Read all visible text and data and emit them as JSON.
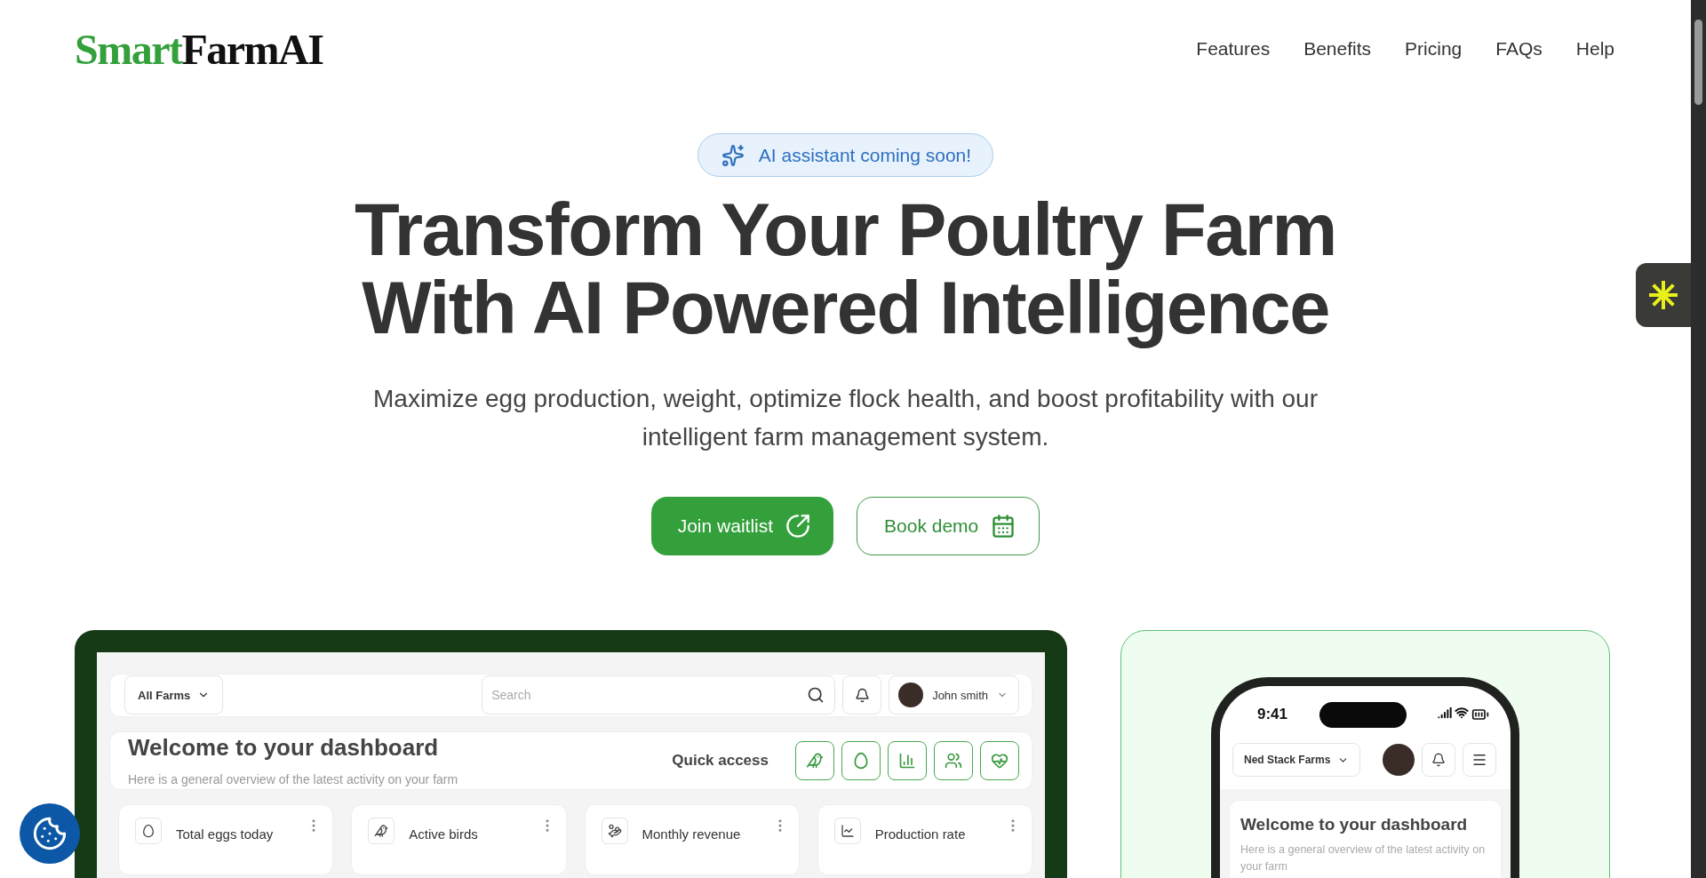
{
  "header": {
    "logo": {
      "accent": "Smart",
      "rest": "FarmAI"
    },
    "nav": [
      "Features",
      "Benefits",
      "Pricing",
      "FAQs",
      "Help"
    ]
  },
  "badge": "AI assistant coming soon!",
  "hero": {
    "title_lines": [
      "Transform Your Poultry Farm",
      "With AI Powered Intelligence"
    ],
    "subtitle_lines": [
      "Maximize egg production, weight, optimize flock health, and boost profitability with our",
      "intelligent farm management system."
    ]
  },
  "buttons": [
    {
      "label": "Join waitlist",
      "kind": "primary"
    },
    {
      "label": "Book demo",
      "kind": "outline"
    }
  ],
  "dashboard": {
    "farm_select": "All Farms",
    "search": {
      "placeholder": "Search"
    },
    "user": "John smith",
    "welcome": {
      "title": "Welcome to your dashboard",
      "subtitle": "Here is a general overview of the latest activity on your farm"
    },
    "quick_access": {
      "label": "Quick access",
      "items": [
        {
          "kind": "bird"
        },
        {
          "kind": "egg"
        },
        {
          "kind": "chart"
        },
        {
          "kind": "users"
        },
        {
          "kind": "health"
        }
      ]
    },
    "stats": [
      {
        "label": "Total eggs today",
        "kind": "egg"
      },
      {
        "label": "Active birds",
        "kind": "bird"
      },
      {
        "label": "Monthly revenue",
        "kind": "money"
      },
      {
        "label": "Production rate",
        "kind": "trend"
      }
    ]
  },
  "phone": {
    "time": "9:41",
    "farm_select": "Ned Stack Farms",
    "welcome": {
      "title": "Welcome to your dashboard",
      "subtitle": "Here is a general overview of the latest activity on your farm"
    }
  }
}
